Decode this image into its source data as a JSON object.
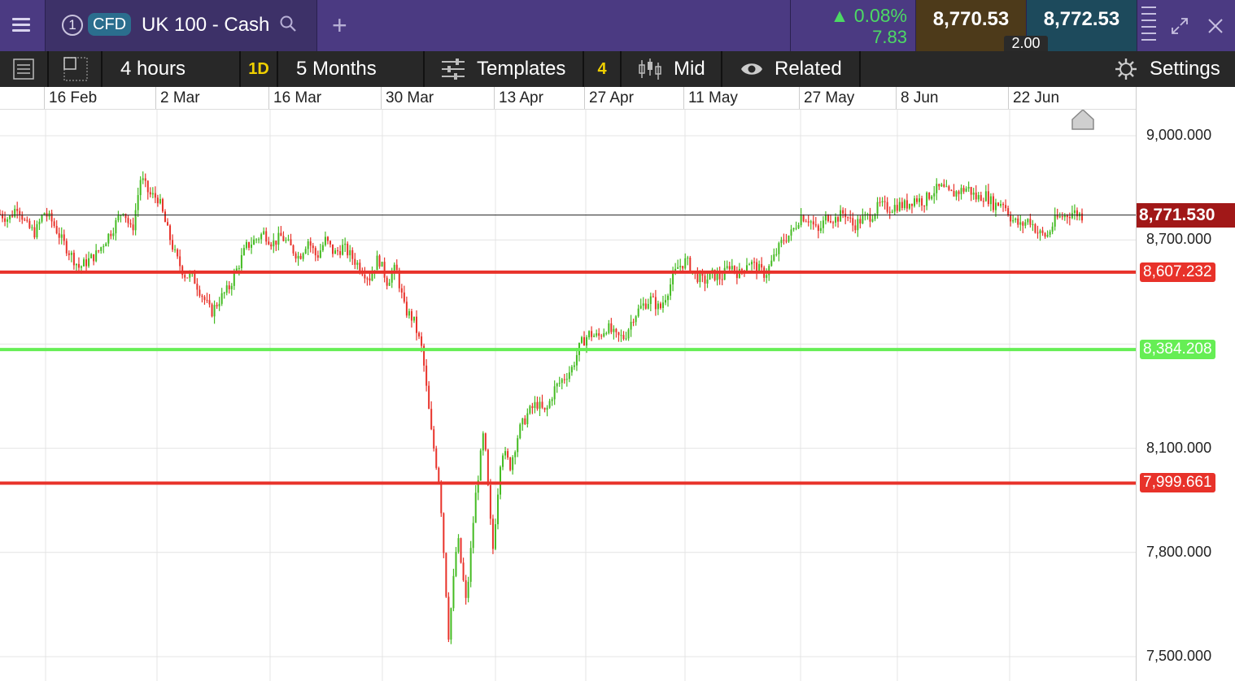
{
  "header": {
    "instance_number": "1",
    "badge": "CFD",
    "instrument": "UK 100 - Cash",
    "change_percent": "0.08%",
    "change_points": "7.83",
    "sell_price": "8,770.53",
    "buy_price": "8,772.53",
    "spread": "2.00",
    "colors": {
      "positive": "#4cd964",
      "header_bg": "#4b3a82"
    }
  },
  "toolbar": {
    "interval": "4 hours",
    "quick_range_badge": "1D",
    "range": "5 Months",
    "templates": "Templates",
    "templates_badge": "4",
    "price_type": "Mid",
    "related": "Related",
    "settings": "Settings"
  },
  "chart_data": {
    "type": "candlestick",
    "x_labels": [
      "16 Feb",
      "2 Mar",
      "16 Mar",
      "30 Mar",
      "13 Apr",
      "27 Apr",
      "11 May",
      "27 May",
      "8 Jun",
      "22 Jun"
    ],
    "y_ticks": [
      "9,000.000",
      "8,700.000",
      "8,100.000",
      "7,800.000",
      "7,500.000"
    ],
    "ylim": [
      7480,
      9070
    ],
    "current_price": "8,771.530",
    "levels": [
      {
        "value": 8607.232,
        "label": "8,607.232",
        "color": "#e8322a"
      },
      {
        "value": 8384.208,
        "label": "8,384.208",
        "color": "#66ee55"
      },
      {
        "value": 7999.661,
        "label": "7,999.661",
        "color": "#e8322a"
      }
    ],
    "colors": {
      "up": "#44bb22",
      "down": "#e8322a"
    },
    "close_path": [
      8775,
      8760,
      8800,
      8740,
      8720,
      8780,
      8750,
      8700,
      8660,
      8620,
      8640,
      8660,
      8700,
      8740,
      8790,
      8720,
      8880,
      8830,
      8820,
      8730,
      8650,
      8600,
      8590,
      8540,
      8490,
      8530,
      8560,
      8620,
      8680,
      8700,
      8720,
      8690,
      8710,
      8680,
      8650,
      8700,
      8650,
      8700,
      8660,
      8680,
      8650,
      8620,
      8590,
      8650,
      8580,
      8620,
      8500,
      8470,
      8380,
      8150,
      7990,
      7560,
      7850,
      7650,
      7950,
      8150,
      7800,
      8100,
      8050,
      8150,
      8200,
      8230,
      8200,
      8270,
      8300,
      8330,
      8400,
      8430,
      8420,
      8450,
      8420,
      8420,
      8480,
      8510,
      8530,
      8500,
      8560,
      8620,
      8640,
      8600,
      8580,
      8600,
      8590,
      8630,
      8600,
      8640,
      8620,
      8600,
      8650,
      8700,
      8720,
      8770,
      8760,
      8720,
      8770,
      8760,
      8780,
      8740,
      8760,
      8770,
      8800,
      8790,
      8800,
      8800,
      8820,
      8810,
      8840,
      8850,
      8830,
      8840,
      8850,
      8820,
      8830,
      8800,
      8810,
      8760,
      8740,
      8760,
      8720,
      8710,
      8760,
      8770,
      8780,
      8770
    ]
  }
}
